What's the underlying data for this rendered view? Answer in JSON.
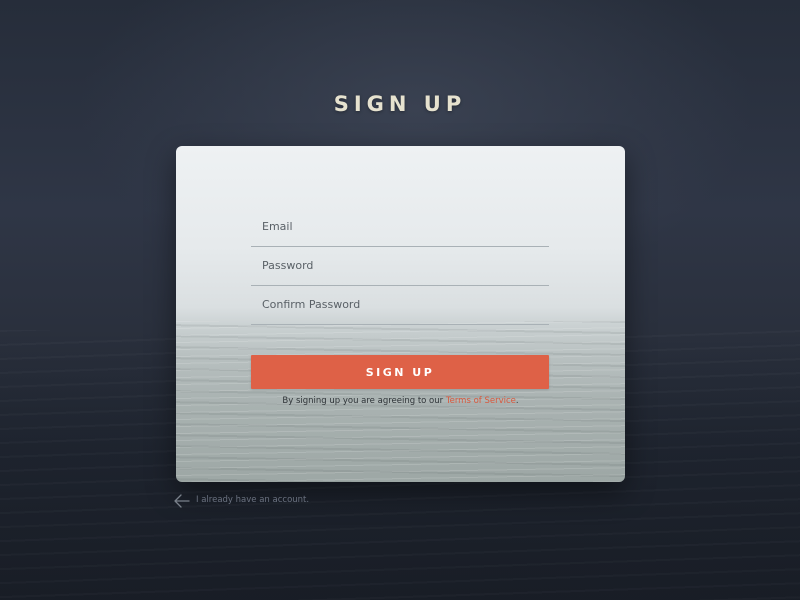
{
  "page": {
    "title": "SIGN UP"
  },
  "form": {
    "email_placeholder": "Email",
    "email_value": "",
    "password_placeholder": "Password",
    "password_value": "",
    "confirm_password_placeholder": "Confirm Password",
    "confirm_password_value": "",
    "submit_label": "SIGN UP",
    "terms_prefix": "By signing up you are agreeing to our ",
    "terms_link": "Terms of Service",
    "terms_suffix": "."
  },
  "footer": {
    "back_label": "I already have an account.",
    "back_icon": "arrow-left-icon"
  },
  "colors": {
    "accent": "#de6147",
    "title": "#e6e2cf",
    "background": "#2a303d"
  }
}
